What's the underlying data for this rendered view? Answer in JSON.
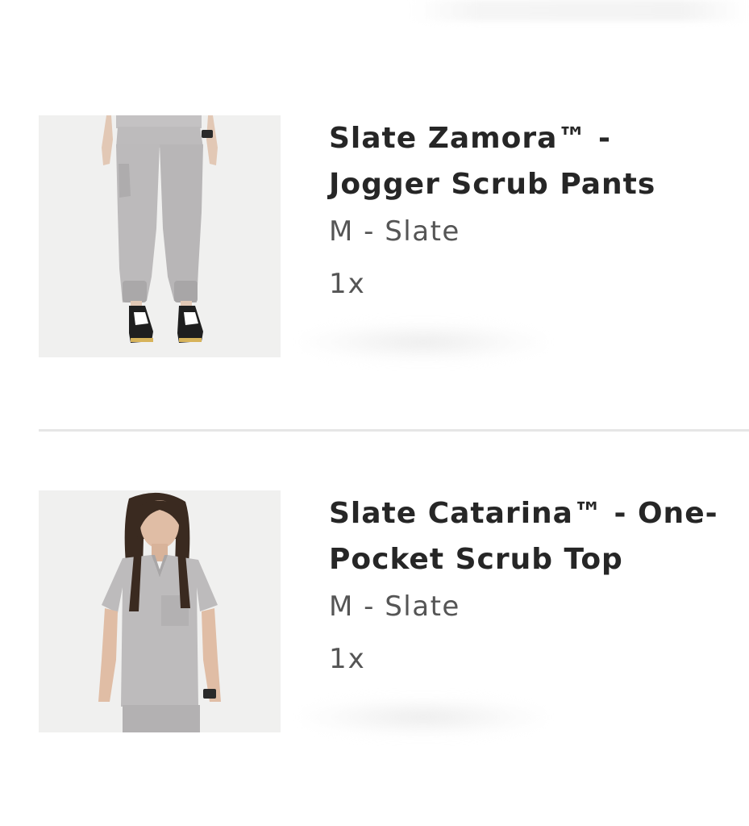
{
  "cart": {
    "items": [
      {
        "title": "Slate Zamora™ - Jogger Scrub Pants",
        "variant": "M - Slate",
        "quantity": "1x",
        "image_icon": "jogger-pants-image"
      },
      {
        "title": "Slate Catarina™ - One-Pocket Scrub Top",
        "variant": "M - Slate",
        "quantity": "1x",
        "image_icon": "scrub-top-image"
      }
    ]
  },
  "colors": {
    "text_primary": "#262626",
    "text_secondary": "#555555",
    "divider": "#e6e6e6",
    "garment": "#bdbbbc"
  }
}
